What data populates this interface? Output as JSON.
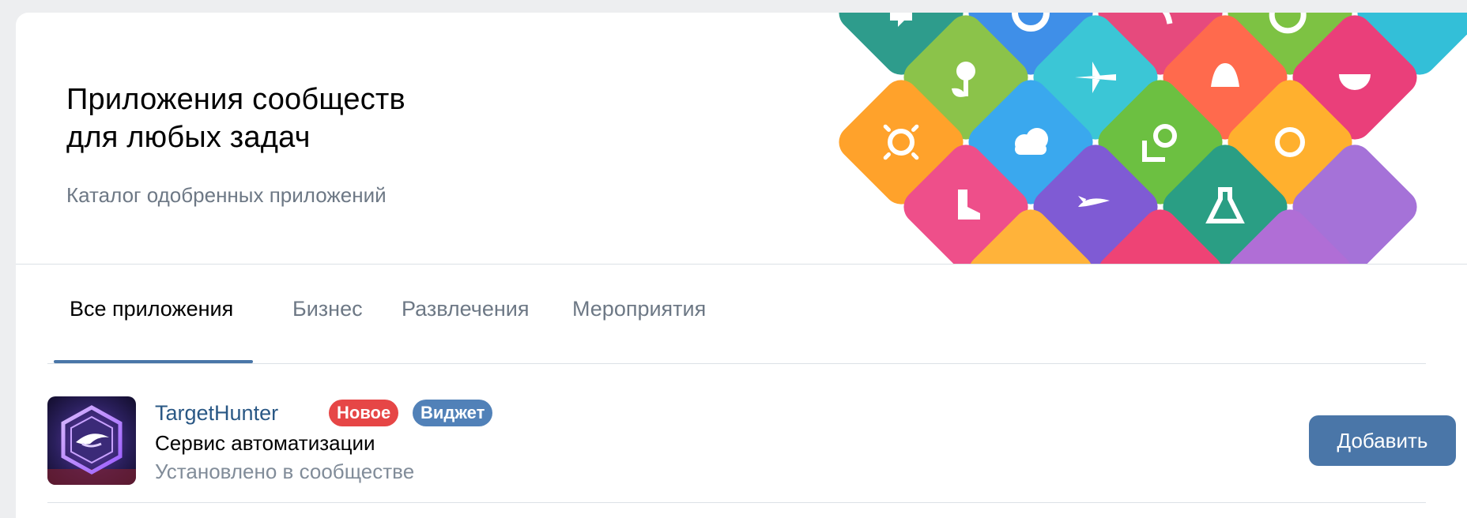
{
  "hero": {
    "title_line1": "Приложения сообществ",
    "title_line2": "для любых задач",
    "subtitle": "Каталог одобренных приложений"
  },
  "tabs": [
    {
      "label": "Все приложения",
      "active": true
    },
    {
      "label": "Бизнес",
      "active": false
    },
    {
      "label": "Развлечения",
      "active": false
    },
    {
      "label": "Мероприятия",
      "active": false
    }
  ],
  "apps": [
    {
      "name": "TargetHunter",
      "badges": [
        "Новое",
        "Виджет"
      ],
      "description": "Сервис автоматизации",
      "status": "Установлено в сообществе",
      "button_label": "Добавить"
    }
  ],
  "colors": {
    "accent": "#4a76a8",
    "link": "#2a5885",
    "badge_new": "#e64646",
    "badge_widget": "#5181b8",
    "secondary_text": "#6d7885",
    "muted_text": "#818c99"
  },
  "tile_icons": [
    "chat-icon",
    "wheel-icon",
    "phone-icon",
    "apple-icon",
    "flower-icon",
    "airplane-icon",
    "bell-icon",
    "bowl-icon",
    "sun-icon",
    "cloud-icon",
    "map-pin-icon",
    "coffee-icon",
    "boot-icon",
    "rocket-icon",
    "flask-icon",
    "camera-icon",
    "leaf-icon",
    "gamepad-icon"
  ]
}
